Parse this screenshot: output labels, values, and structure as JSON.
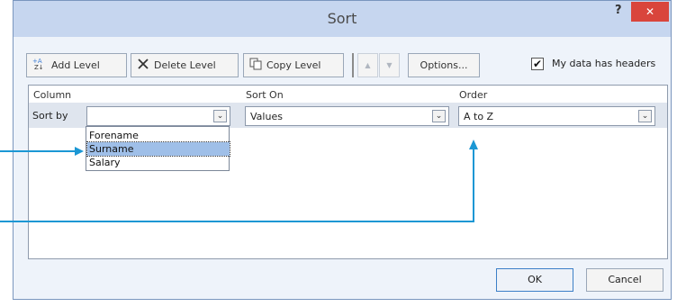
{
  "window": {
    "title": "Sort",
    "help": "?",
    "close": "✕"
  },
  "toolbar": {
    "add_level": "Add Level",
    "delete_level": "Delete Level",
    "copy_level": "Copy Level",
    "move_up": "▲",
    "move_down": "▼",
    "options": "Options...",
    "headers_checked": true,
    "headers_check_mark": "✔",
    "headers_label": "My data has headers"
  },
  "grid": {
    "headers": {
      "column": "Column",
      "sort_on": "Sort On",
      "order": "Order"
    },
    "row": {
      "label": "Sort by",
      "column_value": "",
      "sort_on_value": "Values",
      "order_value": "A to Z"
    }
  },
  "dropdown": {
    "options": [
      "Forename",
      "Surname",
      "Salary"
    ],
    "selected": "Surname"
  },
  "footer": {
    "ok": "OK",
    "cancel": "Cancel"
  },
  "annotation_color": "#1b97d4"
}
